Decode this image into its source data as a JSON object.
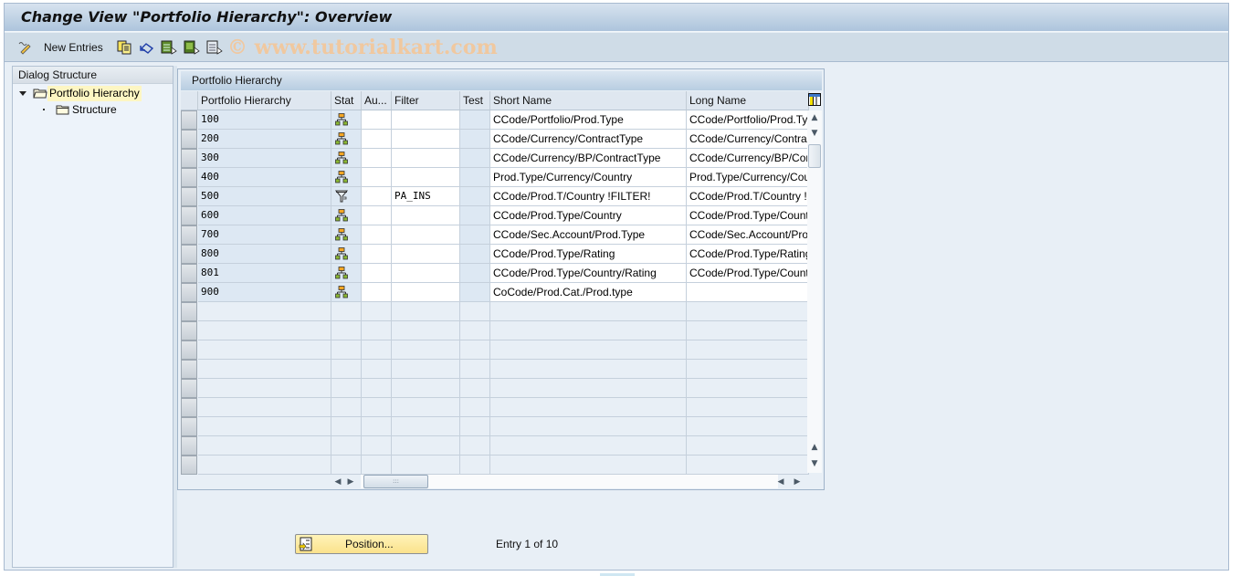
{
  "window": {
    "title": "Change View \"Portfolio Hierarchy\": Overview"
  },
  "toolbar": {
    "items": [
      {
        "name": "display-change-icon",
        "label": ""
      },
      {
        "name": "new-entries",
        "label": "New Entries"
      },
      {
        "name": "copy-as-icon",
        "label": ""
      },
      {
        "name": "undo-change-icon",
        "label": ""
      },
      {
        "name": "select-all-icon",
        "label": ""
      },
      {
        "name": "select-block-icon",
        "label": ""
      },
      {
        "name": "deselect-all-icon",
        "label": ""
      }
    ],
    "watermark": "© www.tutorialkart.com"
  },
  "dialog_structure": {
    "title": "Dialog Structure",
    "items": [
      {
        "label": "Portfolio Hierarchy",
        "level": 0,
        "expanded": true,
        "selected": true,
        "icon": "folder-open-icon"
      },
      {
        "label": "Structure",
        "level": 1,
        "expanded": false,
        "selected": false,
        "icon": "folder-icon"
      }
    ]
  },
  "table": {
    "title": "Portfolio Hierarchy",
    "columns": [
      "Portfolio Hierarchy",
      "Stat",
      "Au...",
      "Filter",
      "Test",
      "Short Name",
      "Long Name"
    ],
    "rows": [
      {
        "id": "100",
        "stat": "hierarchy-icon",
        "au": "",
        "filter": "",
        "test": "",
        "short": "CCode/Portfolio/Prod.Type",
        "long": "CCode/Portfolio/Prod.Ty"
      },
      {
        "id": "200",
        "stat": "hierarchy-icon",
        "au": "",
        "filter": "",
        "test": "",
        "short": "CCode/Currency/ContractType",
        "long": "CCode/Currency/Contrac"
      },
      {
        "id": "300",
        "stat": "hierarchy-icon",
        "au": "",
        "filter": "",
        "test": "",
        "short": "CCode/Currency/BP/ContractType",
        "long": "CCode/Currency/BP/Con"
      },
      {
        "id": "400",
        "stat": "hierarchy-icon",
        "au": "",
        "filter": "",
        "test": "",
        "short": "Prod.Type/Currency/Country",
        "long": "Prod.Type/Currency/Cou"
      },
      {
        "id": "500",
        "stat": "filter-icon",
        "au": "",
        "filter": "PA_INS",
        "test": "",
        "short": "CCode/Prod.T/Country !FILTER!",
        "long": "CCode/Prod.T/Country !"
      },
      {
        "id": "600",
        "stat": "hierarchy-icon",
        "au": "",
        "filter": "",
        "test": "",
        "short": "CCode/Prod.Type/Country",
        "long": "CCode/Prod.Type/Count"
      },
      {
        "id": "700",
        "stat": "hierarchy-icon",
        "au": "",
        "filter": "",
        "test": "",
        "short": "CCode/Sec.Account/Prod.Type",
        "long": "CCode/Sec.Account/Pro"
      },
      {
        "id": "800",
        "stat": "hierarchy-icon",
        "au": "",
        "filter": "",
        "test": "",
        "short": "CCode/Prod.Type/Rating",
        "long": "CCode/Prod.Type/Rating"
      },
      {
        "id": "801",
        "stat": "hierarchy-icon",
        "au": "",
        "filter": "",
        "test": "",
        "short": "CCode/Prod.Type/Country/Rating",
        "long": "CCode/Prod.Type/Count"
      },
      {
        "id": "900",
        "stat": "hierarchy-icon",
        "au": "",
        "filter": "",
        "test": "",
        "short": "CoCode/Prod.Cat./Prod.type",
        "long": ""
      }
    ],
    "empty_rows": 9
  },
  "footer": {
    "position_button": "Position...",
    "entry_info": "Entry 1 of 10"
  }
}
